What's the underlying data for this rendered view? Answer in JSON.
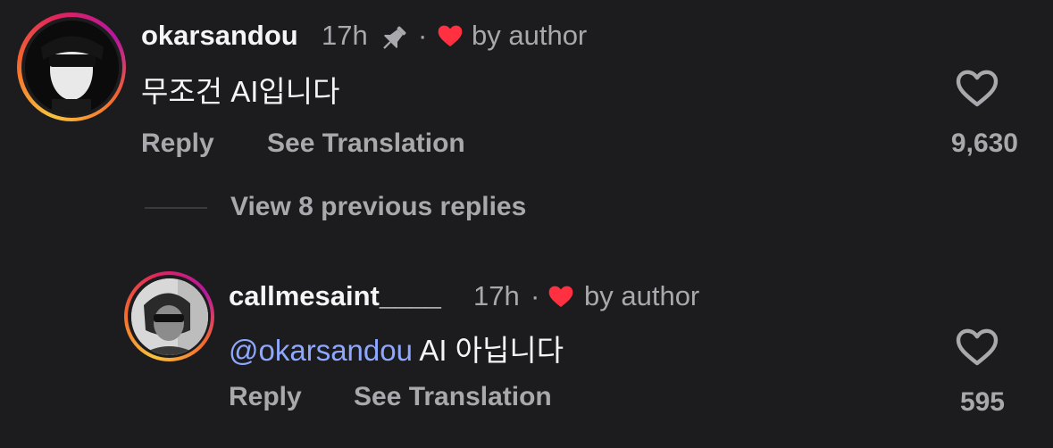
{
  "comments": [
    {
      "username": "okarsandou",
      "time": "17h",
      "liked_by": "by author",
      "text": "무조건 AI입니다",
      "reply_label": "Reply",
      "translate_label": "See Translation",
      "like_count": "9,630"
    },
    {
      "username": "callmesaint____",
      "time": "17h",
      "liked_by": "by author",
      "mention": "@okarsandou",
      "text": "AI 아닙니다",
      "reply_label": "Reply",
      "translate_label": "See Translation",
      "like_count": "595"
    }
  ],
  "replies_toggle": {
    "label": "View 8 previous replies"
  },
  "separator_dot": "·",
  "colors": {
    "background": "#1c1c1e",
    "mention": "#8fa8ff",
    "author_heart": "#ff3040",
    "secondary_text": "#a8a8ad"
  },
  "icons": [
    "pin-icon",
    "heart-filled-icon",
    "heart-outline-icon"
  ]
}
